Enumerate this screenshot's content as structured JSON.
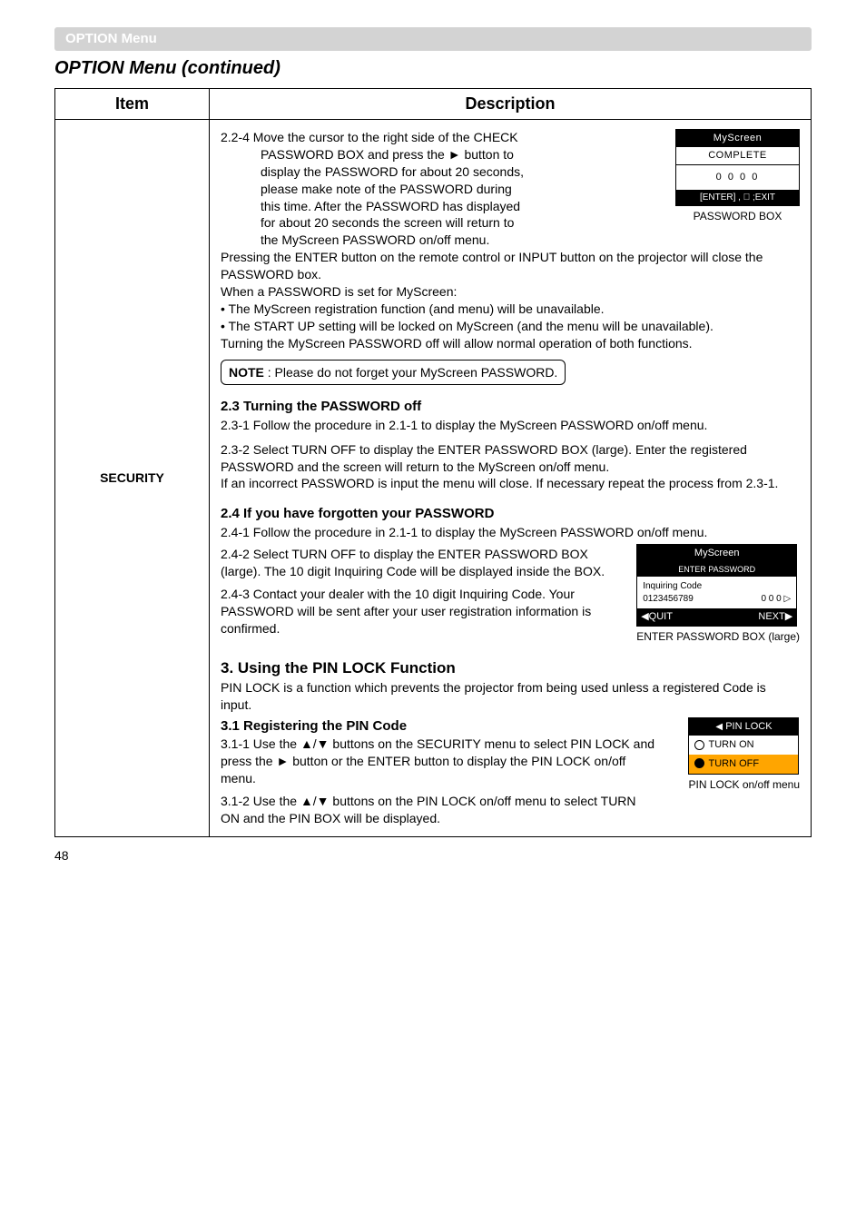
{
  "header": {
    "menu_label": "OPTION Menu"
  },
  "title": "OPTION Menu (continued)",
  "table": {
    "headers": {
      "item": "Item",
      "description": "Description"
    },
    "security_label": "SECURITY",
    "s224": {
      "l1": "2.2-4 Move the cursor to the right side of the CHECK",
      "l2": "PASSWORD BOX and press the ► button to",
      "l3": "display the PASSWORD for about 20 seconds,",
      "l4": "please make note of the PASSWORD during",
      "l5": "this time. After the PASSWORD has displayed",
      "l6": "for about 20 seconds the screen will return to",
      "l7": "the MyScreen PASSWORD on/off menu.",
      "p2": "Pressing the ENTER button on the remote control or INPUT button on the projector will close the PASSWORD box.",
      "p3": "When a PASSWORD is set for MyScreen:",
      "b1": "• The MyScreen registration function (and menu) will be unavailable.",
      "b2": "• The START UP setting will be locked on MyScreen (and the menu will be unavailable).",
      "p4": "Turning the MyScreen PASSWORD off will allow normal operation of both functions.",
      "note": "NOTE : Please do not forget your MyScreen PASSWORD."
    },
    "osd1": {
      "title": "MyScreen",
      "complete": "COMPLETE",
      "digits": "0  0  0  0",
      "foot": "[ENTER] , 󰂨 ;EXIT",
      "caption": "PASSWORD BOX"
    },
    "s23": {
      "h": "2.3 Turning the PASSWORD off",
      "p1": "2.3-1 Follow the procedure in 2.1-1 to display the MyScreen PASSWORD on/off menu.",
      "p2a": "2.3-2 Select TURN OFF to display the ENTER PASSWORD BOX (large). Enter the registered PASSWORD and the screen will return to the MyScreen on/off menu.",
      "p2b": "If an incorrect PASSWORD is input the menu will close. If necessary repeat the process from 2.3-1."
    },
    "s24": {
      "h": "2.4 If you have forgotten your PASSWORD",
      "p1": "2.4-1 Follow the procedure in 2.1-1 to display the MyScreen PASSWORD on/off menu.",
      "p2": "2.4-2 Select TURN OFF to display the ENTER PASSWORD BOX (large). The 10 digit Inquiring Code will be displayed inside the BOX.",
      "p3": "2.4-3 Contact your dealer with the 10 digit Inquiring Code. Your PASSWORD will be sent after your user registration information is confirmed."
    },
    "osd2": {
      "title": "MyScreen",
      "sub": "ENTER PASSWORD",
      "inq": "Inquiring Code",
      "code": "0123456789",
      "right": "0  0  0 ▷",
      "quit": "◀QUIT",
      "next": "NEXT▶",
      "caption": "ENTER PASSWORD BOX (large)"
    },
    "s3": {
      "h": "3. Using the PIN LOCK Function",
      "p1": "PIN LOCK is a function which prevents the projector from being used unless a registered Code is input.",
      "h2": "3.1 Registering the PIN Code",
      "p311": "3.1-1 Use the ▲/▼ buttons on the SECURITY menu to select PIN LOCK and press the ► button or the ENTER button to display the PIN LOCK on/off menu.",
      "p312": "3.1-2 Use the ▲/▼ buttons on the PIN LOCK on/off menu to select TURN ON and the PIN BOX will be displayed."
    },
    "pin": {
      "title": "PIN LOCK",
      "on": "TURN ON",
      "off": "TURN OFF",
      "caption": "PIN LOCK on/off menu"
    }
  },
  "page_number": "48"
}
